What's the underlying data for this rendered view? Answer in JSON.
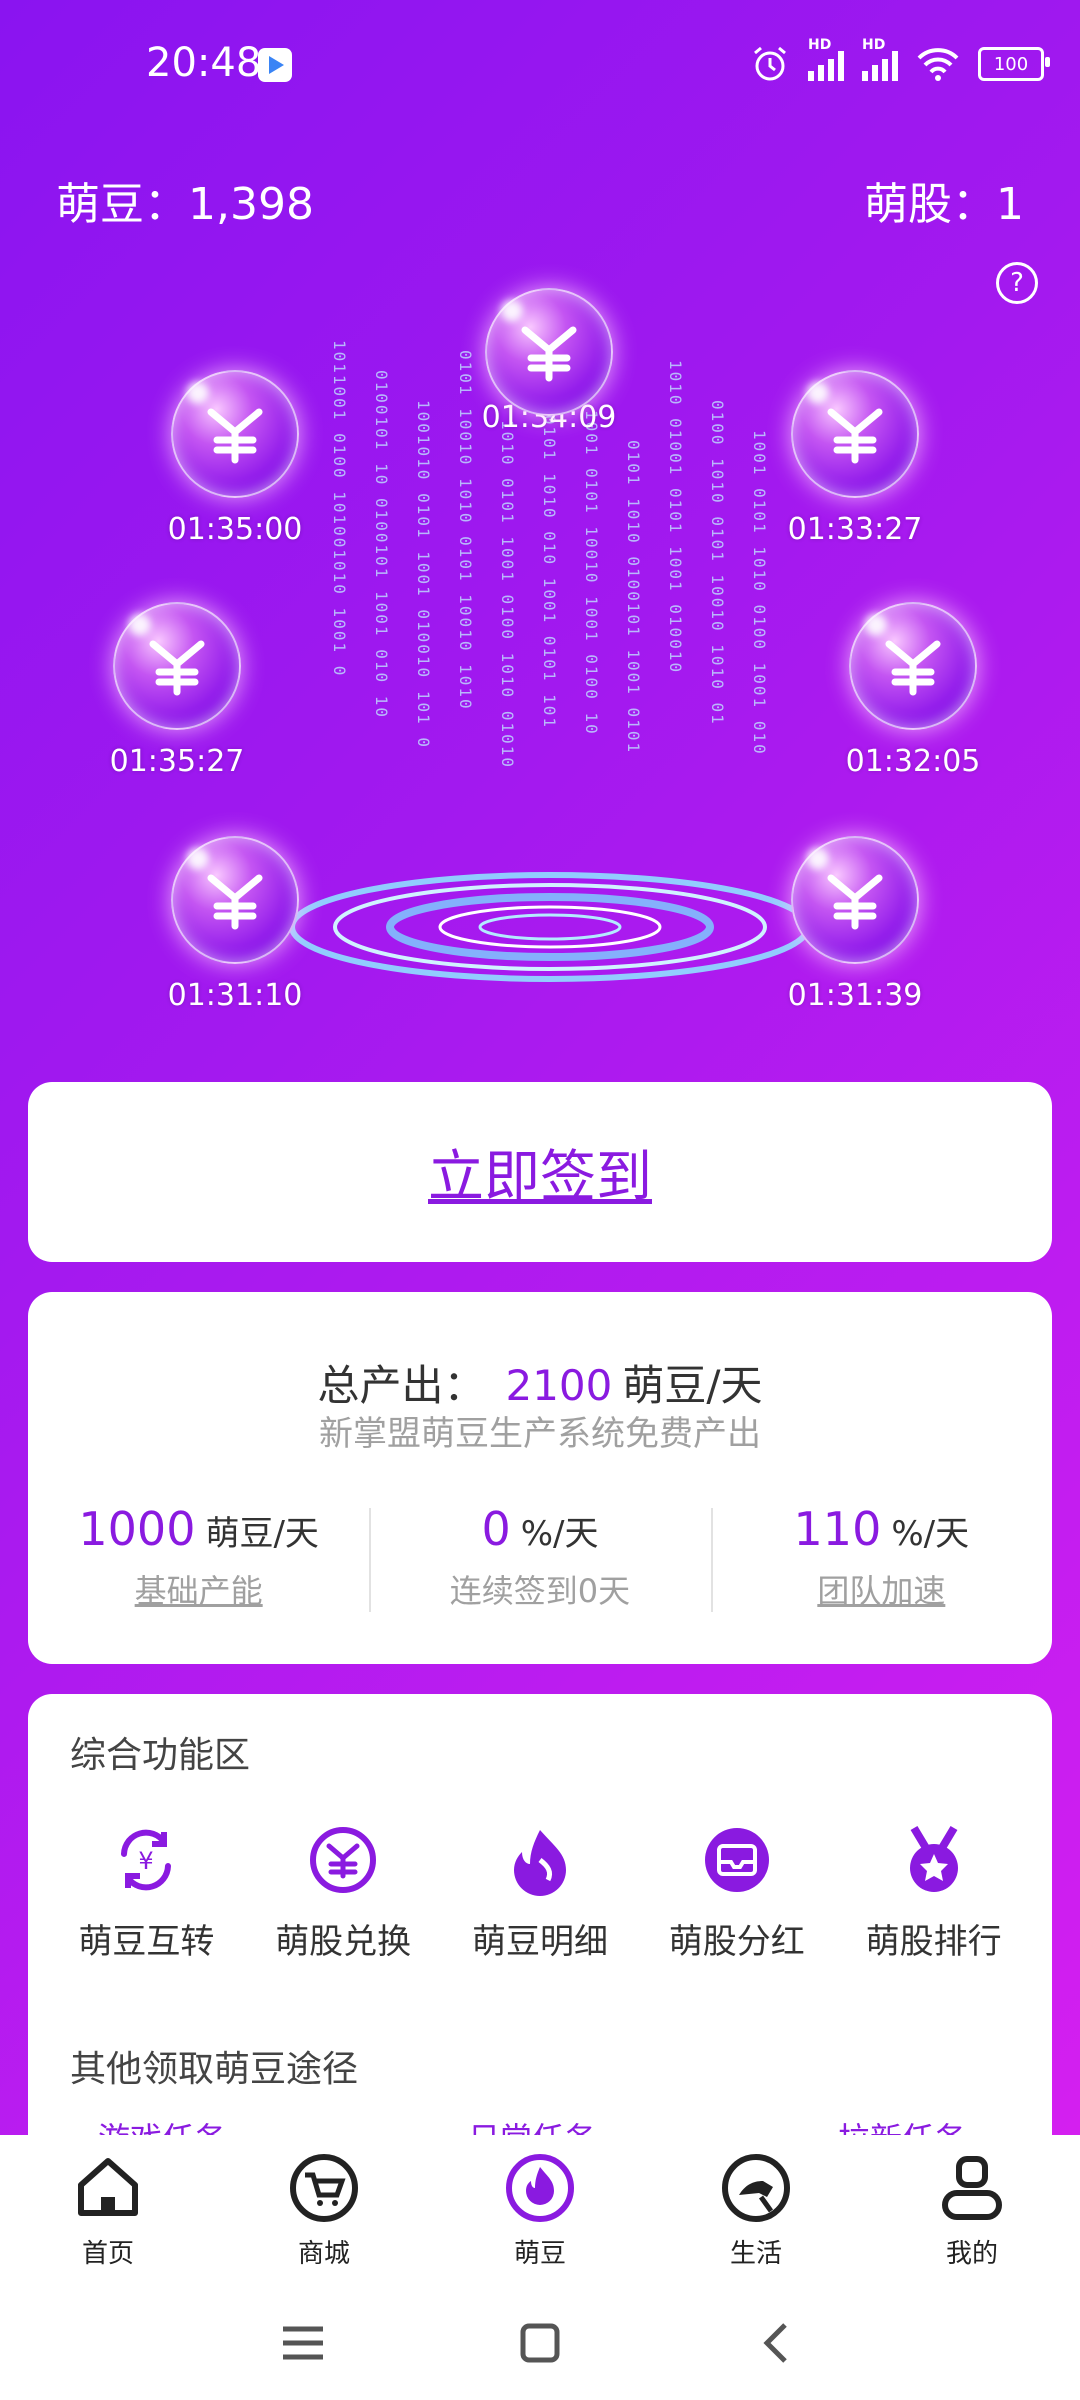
{
  "status_bar": {
    "time": "20:48",
    "battery": "100",
    "net1": "HD",
    "net2": "HD"
  },
  "balances": {
    "beans": "萌豆：1,398",
    "shares": "萌股：1"
  },
  "help_label": "?",
  "bubbles": [
    {
      "time": "01:34:09"
    },
    {
      "time": "01:35:00"
    },
    {
      "time": "01:33:27"
    },
    {
      "time": "01:35:27"
    },
    {
      "time": "01:32:05"
    },
    {
      "time": "01:31:10"
    },
    {
      "time": "01:31:39"
    }
  ],
  "signin_label": "立即签到",
  "output": {
    "label": "总产出：",
    "value": "2100",
    "unit": "萌豆/天",
    "subtitle": "新掌盟萌豆生产系统免费产出",
    "stats": [
      {
        "value": "1000",
        "unit": "萌豆/天",
        "label": "基础产能"
      },
      {
        "value": "0",
        "unit": "%/天",
        "label": "连续签到0天"
      },
      {
        "value": "110",
        "unit": "%/天",
        "label": "团队加速"
      }
    ]
  },
  "functions": {
    "title": "综合功能区",
    "items": [
      {
        "label": "萌豆互转",
        "icon": "exchange-yen-icon"
      },
      {
        "label": "萌股兑换",
        "icon": "share-exchange-icon"
      },
      {
        "label": "萌豆明细",
        "icon": "flame-detail-icon"
      },
      {
        "label": "萌股分红",
        "icon": "dividend-inbox-icon"
      },
      {
        "label": "萌股排行",
        "icon": "ranking-medal-icon"
      }
    ],
    "other_title": "其他领取萌豆途径",
    "tasks": [
      "游戏任务",
      "日常任务",
      "拉新任务"
    ]
  },
  "nav": [
    {
      "label": "首页",
      "icon": "home-icon"
    },
    {
      "label": "商城",
      "icon": "cart-icon"
    },
    {
      "label": "萌豆",
      "icon": "flame-icon"
    },
    {
      "label": "生活",
      "icon": "fuel-icon"
    },
    {
      "label": "我的",
      "icon": "user-icon"
    }
  ],
  "colors": {
    "accent": "#8a1ae0",
    "gradient_start": "#8a14f0",
    "gradient_end": "#d41ff0"
  }
}
